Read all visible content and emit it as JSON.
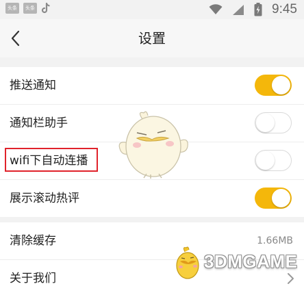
{
  "status_bar": {
    "app_icons": [
      "头条",
      "头条"
    ],
    "time": "9:45"
  },
  "header": {
    "title": "设置"
  },
  "settings": {
    "toggles": [
      {
        "label": "推送通知",
        "on": true
      },
      {
        "label": "通知栏助手",
        "on": false
      },
      {
        "label": "wifi下自动连播",
        "on": false
      },
      {
        "label": "展示滚动热评",
        "on": true
      }
    ],
    "clear_cache": {
      "label": "清除缓存",
      "value": "1.66MB"
    },
    "about": {
      "label": "关于我们"
    }
  },
  "watermark": {
    "text": "3DMGAME"
  },
  "colors": {
    "accent": "#f4b70b",
    "highlight": "#e0222a"
  }
}
